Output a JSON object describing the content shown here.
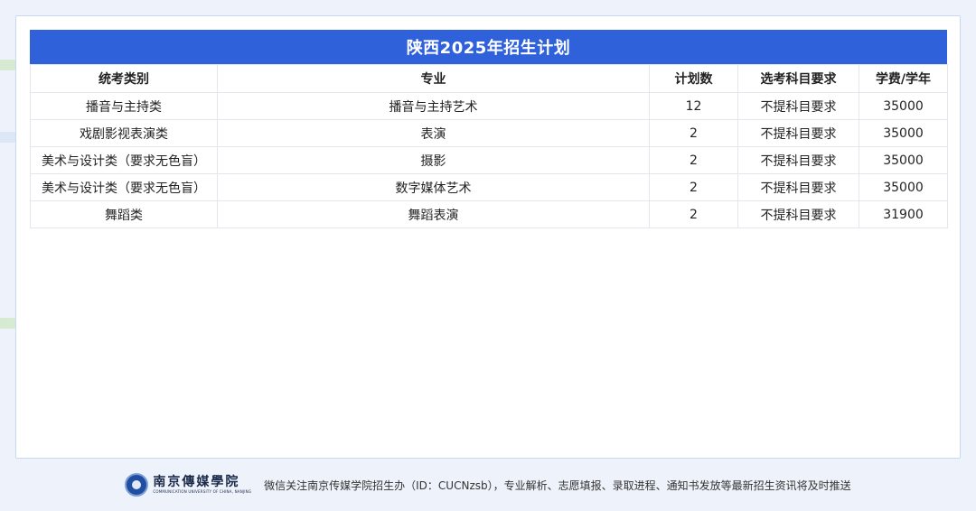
{
  "title": "陕西2025年招生计划",
  "columns": [
    "统考类别",
    "专业",
    "计划数",
    "选考科目要求",
    "学费/学年"
  ],
  "rows": [
    [
      "播音与主持类",
      "播音与主持艺术",
      "12",
      "不提科目要求",
      "35000"
    ],
    [
      "戏剧影视表演类",
      "表演",
      "2",
      "不提科目要求",
      "35000"
    ],
    [
      "美术与设计类（要求无色盲）",
      "摄影",
      "2",
      "不提科目要求",
      "35000"
    ],
    [
      "美术与设计类（要求无色盲）",
      "数字媒体艺术",
      "2",
      "不提科目要求",
      "35000"
    ],
    [
      "舞蹈类",
      "舞蹈表演",
      "2",
      "不提科目要求",
      "31900"
    ]
  ],
  "footer": {
    "logo_cn": "南京傳媒學院",
    "logo_en": "COMMUNICATION UNIVERSITY OF CHINA, NANJING",
    "text": "微信关注南京传媒学院招生办（ID：CUCNzsb），专业解析、志愿填报、录取进程、通知书发放等最新招生资讯将及时推送"
  },
  "colors": {
    "header_bg": "#2f61db",
    "page_bg": "#eef3fb",
    "deco": "#cfe7c9"
  }
}
